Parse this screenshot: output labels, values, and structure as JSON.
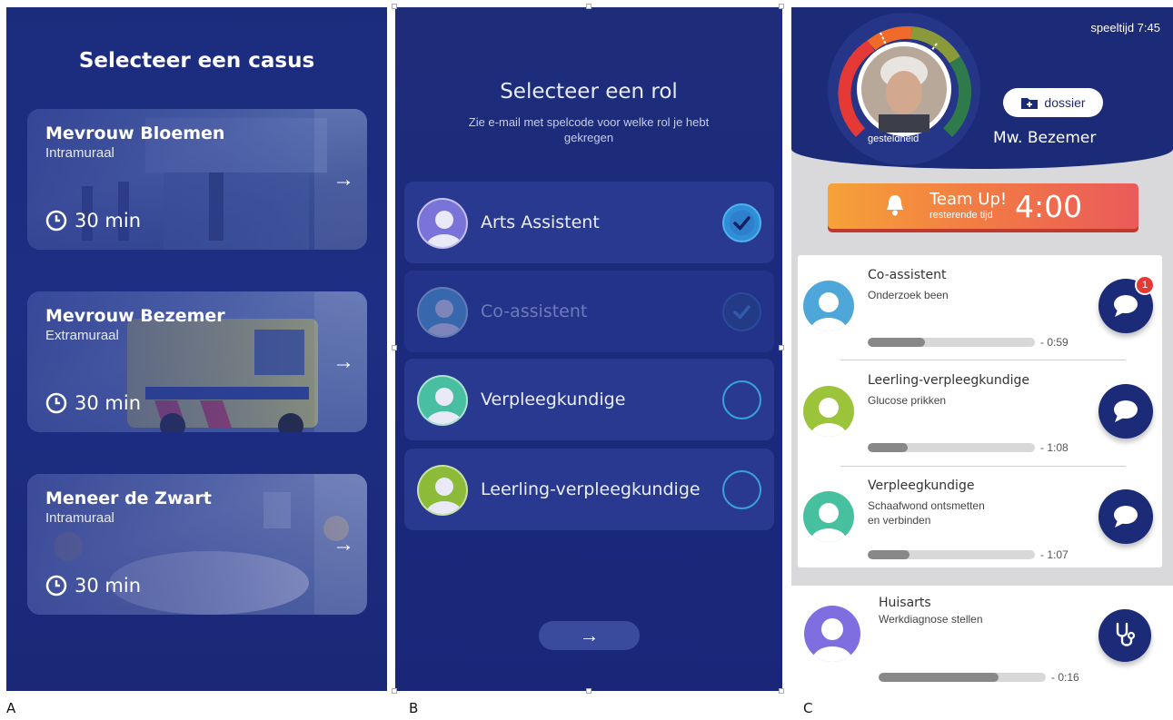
{
  "captions": [
    "A",
    "B",
    "C"
  ],
  "panel_a": {
    "title": "Selecteer een casus",
    "cases": [
      {
        "name": "Mevrouw Bloemen",
        "type": "Intramuraal",
        "duration": "30 min",
        "arrow": "→"
      },
      {
        "name": "Mevrouw Bezemer",
        "type": "Extramuraal",
        "duration": "30 min",
        "arrow": "→"
      },
      {
        "name": "Meneer de Zwart",
        "type": "Intramuraal",
        "duration": "30 min",
        "arrow": "→"
      }
    ]
  },
  "panel_b": {
    "title": "Selecteer een rol",
    "subtitle": "Zie e-mail met spelcode voor welke rol je hebt gekregen",
    "roles": [
      {
        "label": "Arts Assistent",
        "state": "selected"
      },
      {
        "label": "Co-assistent",
        "state": "disabled"
      },
      {
        "label": "Verpleegkundige",
        "state": "unselected"
      },
      {
        "label": "Leerling-verpleegkundige",
        "state": "unselected"
      }
    ],
    "next_arrow": "→"
  },
  "panel_c": {
    "playtime": "speeltijd 7:45",
    "health_label": "gesteldheid",
    "dossier_label": "dossier",
    "patient_name": "Mw. Bezemer",
    "teamup": {
      "title": "Team Up!",
      "subtitle": "resterende tijd",
      "time": "4:00"
    },
    "tasks": [
      {
        "role": "Co-assistent",
        "task": "Onderzoek been",
        "progress": 0.34,
        "time": "- 0:59",
        "badge": "1"
      },
      {
        "role": "Leerling-verpleegkundige",
        "task": "Glucose prikken",
        "progress": 0.24,
        "time": "- 1:08"
      },
      {
        "role": "Verpleegkundige",
        "task": "Schaafwond ontsmetten en verbinden",
        "progress": 0.25,
        "time": "- 1:07"
      }
    ],
    "huisarts": {
      "role": "Huisarts",
      "task": "Werkdiagnose stellen",
      "progress": 0.72,
      "time": "- 0:16"
    }
  },
  "colors": {
    "navy": "#1c2b78",
    "accent_blue": "#3aa0e0",
    "badge_red": "#e53935",
    "teamup_orange": "#f5a238",
    "teamup_red": "#ea5a5a"
  }
}
